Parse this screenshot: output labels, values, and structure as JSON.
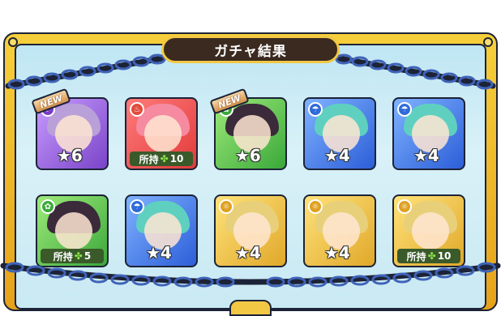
{
  "title": "ガチャ結果",
  "cards": [
    {
      "name": "purple-haired character",
      "color": "purple",
      "element": "dark",
      "element_icon": "☾",
      "new": true,
      "new_label": "NEW",
      "rarity_label": "★6",
      "owned": false
    },
    {
      "name": "pink-haired character",
      "color": "red",
      "element": "fire",
      "element_icon": "♨",
      "new": false,
      "rarity_label": "",
      "owned": true,
      "owned_label": "所持",
      "owned_count": "10"
    },
    {
      "name": "dark-haired character",
      "color": "green",
      "element": "wood",
      "element_icon": "✿",
      "new": true,
      "new_label": "NEW",
      "rarity_label": "★6",
      "owned": false
    },
    {
      "name": "teal-haired character",
      "color": "blue",
      "element": "water",
      "element_icon": "☂",
      "new": false,
      "rarity_label": "★4",
      "owned": false
    },
    {
      "name": "blue creature",
      "color": "blue",
      "element": "water",
      "element_icon": "☂",
      "new": false,
      "rarity_label": "★4",
      "owned": false
    },
    {
      "name": "white-haired character",
      "color": "green",
      "element": "wood",
      "element_icon": "✿",
      "new": false,
      "rarity_label": "",
      "owned": true,
      "owned_label": "所持",
      "owned_count": "5"
    },
    {
      "name": "green-haired character",
      "color": "blue",
      "element": "water",
      "element_icon": "☂",
      "new": false,
      "rarity_label": "★4",
      "owned": false
    },
    {
      "name": "lion beast",
      "color": "yellow",
      "element": "light",
      "element_icon": "☼",
      "new": false,
      "rarity_label": "★4",
      "owned": false
    },
    {
      "name": "blonde character",
      "color": "yellow",
      "element": "light",
      "element_icon": "☼",
      "new": false,
      "rarity_label": "★4",
      "owned": false
    },
    {
      "name": "old warrior",
      "color": "yellow",
      "element": "light",
      "element_icon": "☼",
      "new": false,
      "rarity_label": "",
      "owned": true,
      "owned_label": "所持",
      "owned_count": "10"
    }
  ]
}
